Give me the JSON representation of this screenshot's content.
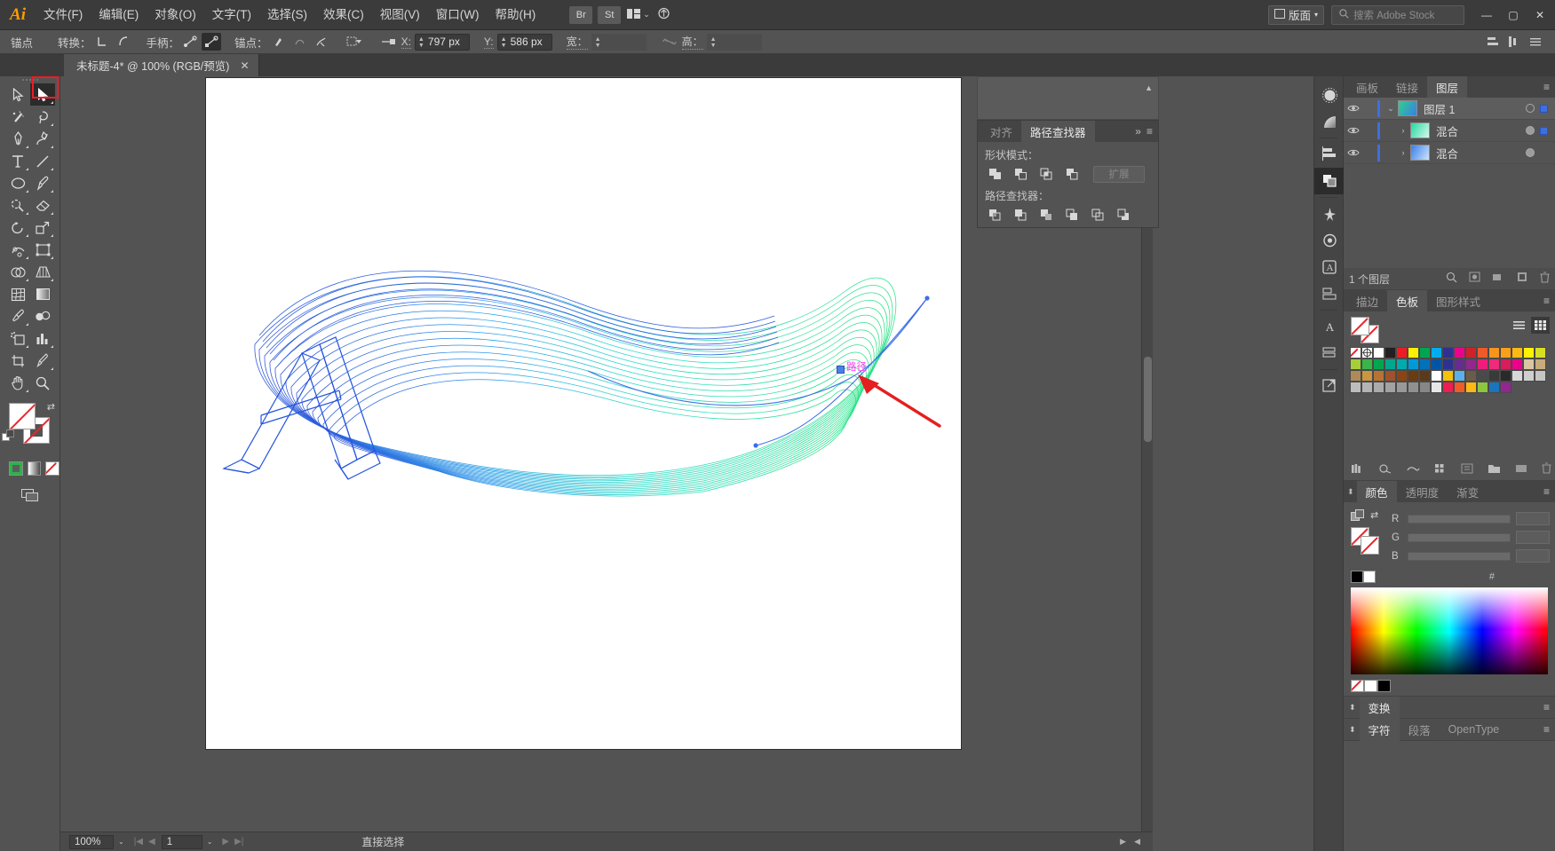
{
  "app": {
    "name": "Adobe Illustrator",
    "logo": "Ai"
  },
  "menubar": {
    "items": [
      {
        "label": "文件(F)",
        "name": "menu-file"
      },
      {
        "label": "编辑(E)",
        "name": "menu-edit"
      },
      {
        "label": "对象(O)",
        "name": "menu-object"
      },
      {
        "label": "文字(T)",
        "name": "menu-type"
      },
      {
        "label": "选择(S)",
        "name": "menu-select"
      },
      {
        "label": "效果(C)",
        "name": "menu-effect"
      },
      {
        "label": "视图(V)",
        "name": "menu-view"
      },
      {
        "label": "窗口(W)",
        "name": "menu-window"
      },
      {
        "label": "帮助(H)",
        "name": "menu-help"
      }
    ],
    "bridge_label": "Br",
    "stock_label": "St",
    "arrange_label": "▦",
    "artboard_dropdown": "版面",
    "stock_search_placeholder": "搜索 Adobe Stock",
    "window_minimize": "—",
    "window_maximize": "▢",
    "window_close": "✕"
  },
  "controlbar": {
    "anchor_label": "锚点",
    "convert_label": "转换：",
    "handles_label": "手柄：",
    "anchors_label": "锚点：",
    "x_label": "X:",
    "x_value": "797 px",
    "y_label": "Y:",
    "y_value": "586 px",
    "width_label": "宽：",
    "width_value": "",
    "height_label": "高：",
    "height_value": ""
  },
  "document_tab": {
    "title": "未标题-4* @ 100% (RGB/预览)",
    "close": "✕"
  },
  "toolbar": {
    "tools": [
      {
        "name": "selection-tool",
        "label": "选择工具",
        "selected": false
      },
      {
        "name": "direct-selection-tool",
        "label": "直接选择工具",
        "selected": true
      },
      {
        "name": "magic-wand-tool",
        "label": "魔棒工具",
        "selected": false
      },
      {
        "name": "lasso-tool",
        "label": "套索工具",
        "selected": false
      },
      {
        "name": "pen-tool",
        "label": "钢笔工具",
        "selected": false
      },
      {
        "name": "curvature-tool",
        "label": "曲率工具",
        "selected": false
      },
      {
        "name": "type-tool",
        "label": "文字工具",
        "selected": false
      },
      {
        "name": "line-segment-tool",
        "label": "直线段工具",
        "selected": false
      },
      {
        "name": "ellipse-tool",
        "label": "椭圆工具",
        "selected": false
      },
      {
        "name": "paintbrush-tool",
        "label": "画笔工具",
        "selected": false
      },
      {
        "name": "shaper-tool",
        "label": "Shaper 工具",
        "selected": false
      },
      {
        "name": "eraser-tool",
        "label": "橡皮擦工具",
        "selected": false
      },
      {
        "name": "rotate-tool",
        "label": "旋转工具",
        "selected": false
      },
      {
        "name": "scale-tool",
        "label": "比例缩放工具",
        "selected": false
      },
      {
        "name": "width-tool",
        "label": "宽度工具",
        "selected": false
      },
      {
        "name": "free-transform-tool",
        "label": "自由变换工具",
        "selected": false
      },
      {
        "name": "shape-builder-tool",
        "label": "形状生成器工具",
        "selected": false
      },
      {
        "name": "perspective-grid-tool",
        "label": "透视网格工具",
        "selected": false
      },
      {
        "name": "mesh-tool",
        "label": "网格工具",
        "selected": false
      },
      {
        "name": "gradient-tool",
        "label": "渐变工具",
        "selected": false
      },
      {
        "name": "eyedropper-tool",
        "label": "吸管工具",
        "selected": false
      },
      {
        "name": "blend-tool",
        "label": "混合工具",
        "selected": false
      },
      {
        "name": "symbol-sprayer-tool",
        "label": "符号喷枪工具",
        "selected": false
      },
      {
        "name": "column-graph-tool",
        "label": "柱形图工具",
        "selected": false
      },
      {
        "name": "artboard-tool",
        "label": "画板工具",
        "selected": false
      },
      {
        "name": "slice-tool",
        "label": "切片工具",
        "selected": false
      },
      {
        "name": "hand-tool",
        "label": "抓手工具",
        "selected": false
      },
      {
        "name": "zoom-tool",
        "label": "缩放工具",
        "selected": false
      }
    ],
    "fill_state": "none",
    "stroke_state": "none",
    "color_modes": [
      {
        "name": "color-mode-color",
        "label": "颜色"
      },
      {
        "name": "color-mode-gradient",
        "label": "渐变"
      },
      {
        "name": "color-mode-none",
        "label": "无"
      }
    ]
  },
  "canvas": {
    "smart_guide_label": "路径",
    "artwork_description": "蓝绿渐变混合线框艺术字 A",
    "annotation_arrow_color": "#e41f1f",
    "anchor_color": "#4d7fe8",
    "path_color_start": "#1f5de0",
    "path_color_end": "#1ee08a"
  },
  "statusbar": {
    "zoom_value": "100%",
    "page_value": "1",
    "status_text": "直接选择",
    "caret": "⌄",
    "first": "|◀",
    "prev": "◀",
    "next": "▶",
    "last": "▶|"
  },
  "dockstrip": {
    "items": [
      {
        "name": "dock-brushes-icon",
        "label": "画笔",
        "active": false
      },
      {
        "name": "dock-gradient-icon",
        "label": "渐变",
        "active": false
      },
      {
        "name": "dock-align-icon",
        "label": "对齐",
        "active": false
      },
      {
        "name": "dock-pathfinder-icon",
        "label": "路径查找器",
        "active": true
      },
      {
        "name": "dock-symbols-icon",
        "label": "符号",
        "active": false
      },
      {
        "name": "dock-appearance-icon",
        "label": "外观",
        "active": false
      },
      {
        "name": "dock-graphic-styles-icon",
        "label": "图形样式",
        "active": false
      },
      {
        "name": "dock-character-icon",
        "label": "字符",
        "active": false
      },
      {
        "name": "dock-export-icon",
        "label": "资源导出",
        "active": false
      }
    ]
  },
  "panels": {
    "layers": {
      "tabs": [
        {
          "label": "画板",
          "name": "tab-artboards",
          "active": false
        },
        {
          "label": "链接",
          "name": "tab-links",
          "active": false
        },
        {
          "label": "图层",
          "name": "tab-layers",
          "active": true
        }
      ],
      "rows": [
        {
          "name": "图层 1",
          "indent": 0,
          "twisty": "⌄",
          "selected": true,
          "target_filled": false,
          "has_target": true,
          "thumb_from": "#2fd08a",
          "thumb_to": "#3a7fe8"
        },
        {
          "name": "混合",
          "indent": 1,
          "twisty": "›",
          "selected": false,
          "target_filled": true,
          "has_target": true,
          "thumb_from": "#25d9a0",
          "thumb_to": "#8ef0c8"
        },
        {
          "name": "混合",
          "indent": 1,
          "twisty": "›",
          "selected": false,
          "target_filled": true,
          "has_target": false,
          "thumb_from": "#3a7fe8",
          "thumb_to": "#9fc6f5"
        }
      ],
      "footer_count": "1 个图层"
    },
    "pathfinder": {
      "tabs": [
        {
          "label": "对齐",
          "name": "tab-align",
          "active": false
        },
        {
          "label": "路径查找器",
          "name": "tab-pathfinder",
          "active": true
        }
      ],
      "shape_modes_label": "形状模式：",
      "pathfinders_label": "路径查找器：",
      "expand_label": "扩展",
      "shape_mode_buttons": [
        {
          "name": "unite-button",
          "label": "联集"
        },
        {
          "name": "minus-front-button",
          "label": "减去顶层"
        },
        {
          "name": "intersect-button",
          "label": "交集"
        },
        {
          "name": "exclude-button",
          "label": "差集"
        }
      ],
      "pathfinder_buttons": [
        {
          "name": "divide-button",
          "label": "分割"
        },
        {
          "name": "trim-button",
          "label": "修边"
        },
        {
          "name": "merge-button",
          "label": "合并"
        },
        {
          "name": "crop-button",
          "label": "裁剪"
        },
        {
          "name": "outline-button",
          "label": "轮廓"
        },
        {
          "name": "minus-back-button",
          "label": "减去后方对象"
        }
      ]
    },
    "swatches": {
      "tabs": [
        {
          "label": "描边",
          "name": "tab-stroke",
          "active": false
        },
        {
          "label": "色板",
          "name": "tab-swatches",
          "active": true
        },
        {
          "label": "图形样式",
          "name": "tab-graphic-styles",
          "active": false
        }
      ],
      "colors": [
        "none",
        "registration",
        "#ffffff",
        "#231f20",
        "#ec1c24",
        "#fff100",
        "#00a551",
        "#00aeef",
        "#2f3192",
        "#ec008c",
        "#cf2129",
        "#f05a28",
        "#f7941d",
        "#f9a01b",
        "#fdb913",
        "#fff200",
        "#d7df23",
        "#a6ce39",
        "#39b54a",
        "#00a64f",
        "#00a78e",
        "#00aaad",
        "#0099d9",
        "#0072bc",
        "#0054a6",
        "#2e3192",
        "#652d90",
        "#92278f",
        "#ed1e79",
        "#ee2a7b",
        "#d91c5c",
        "#ec008c",
        "#d9c5a0",
        "#c9ab7c",
        "#ae8a5a",
        "#c8973f",
        "#b87333",
        "#a0522d",
        "#8b4513",
        "#6b3b12",
        "#5a3a1a",
        "#ffffff",
        "#f4c20d",
        "#5ab0e8",
        "#6b5b4a",
        "#4a4a4a",
        "#3a3a3a",
        "#2a2a2a",
        "#d8d8d8",
        "#cfcfcf",
        "#c6c6c6",
        "#bdbdbd",
        "#b4b4b4",
        "#ababab",
        "#a2a2a2",
        "#999999",
        "#909090",
        "#878787",
        "#e6e6e6",
        "#ee1d52",
        "#f15a29",
        "#fdb913",
        "#8dc63f",
        "#1b75bc",
        "#92278f"
      ],
      "footer_icons": [
        "swatch-libraries-icon",
        "show-swatch-kinds-icon",
        "swatch-options-icon",
        "new-group-icon",
        "new-swatch-icon",
        "delete-swatch-icon"
      ]
    },
    "color": {
      "tabs": [
        {
          "label": "颜色",
          "name": "tab-color",
          "active": true
        },
        {
          "label": "透明度",
          "name": "tab-transparency",
          "active": false
        },
        {
          "label": "渐变",
          "name": "tab-gradient",
          "active": false
        }
      ],
      "channels": [
        {
          "label": "R",
          "value": ""
        },
        {
          "label": "G",
          "value": ""
        },
        {
          "label": "B",
          "value": ""
        }
      ],
      "hex_label": "#",
      "hex_value": ""
    },
    "transform": {
      "tabs": [
        {
          "label": "变换",
          "name": "tab-transform",
          "active": true
        }
      ]
    },
    "character": {
      "tabs": [
        {
          "label": "字符",
          "name": "tab-character",
          "active": true
        },
        {
          "label": "段落",
          "name": "tab-paragraph",
          "active": false
        },
        {
          "label": "OpenType",
          "name": "tab-opentype",
          "active": false
        }
      ]
    }
  }
}
